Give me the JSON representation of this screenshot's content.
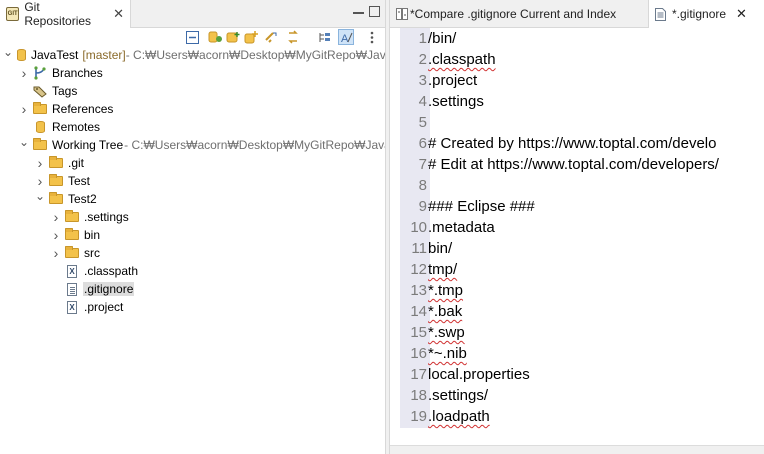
{
  "left_panel": {
    "tab_title": "Git Repositories",
    "tab_close": "✕",
    "git_icon_text": "GIT",
    "toolbar_icons": [
      "collapse-all-icon",
      "clone-repo-icon",
      "add-repo-icon",
      "create-repo-icon",
      "link-editor-icon",
      "refresh-icon",
      "flat-layout-icon",
      "show-content-icon",
      "view-menu-icon"
    ],
    "tree": [
      {
        "id": "javatest",
        "level": 0,
        "expanded": true,
        "icon": "repo-icon",
        "label": "JavaTest",
        "tag": "[master]",
        "path": " - C:₩Users₩acorn₩Desktop₩MyGitRepo₩JavaT"
      },
      {
        "id": "branches",
        "level": 1,
        "expanded": false,
        "icon": "branches-icon",
        "label": "Branches"
      },
      {
        "id": "tags",
        "level": 1,
        "expanded": null,
        "icon": "tags-icon",
        "label": "Tags"
      },
      {
        "id": "references",
        "level": 1,
        "expanded": false,
        "icon": "folder-icon",
        "label": "References"
      },
      {
        "id": "remotes",
        "level": 1,
        "expanded": null,
        "icon": "remotes-icon",
        "label": "Remotes"
      },
      {
        "id": "working-tree",
        "level": 1,
        "expanded": true,
        "icon": "folder-icon",
        "label": "Working Tree",
        "path": " - C:₩Users₩acorn₩Desktop₩MyGitRepo₩JavaT"
      },
      {
        "id": "git",
        "level": 2,
        "expanded": false,
        "icon": "folder-icon",
        "label": ".git"
      },
      {
        "id": "test",
        "level": 2,
        "expanded": false,
        "icon": "folder-icon",
        "label": "Test"
      },
      {
        "id": "test2",
        "level": 2,
        "expanded": true,
        "icon": "folder-icon",
        "label": "Test2"
      },
      {
        "id": "settings",
        "level": 3,
        "expanded": false,
        "icon": "folder-icon",
        "label": ".settings"
      },
      {
        "id": "bin",
        "level": 3,
        "expanded": false,
        "icon": "folder-icon",
        "label": "bin"
      },
      {
        "id": "src",
        "level": 3,
        "expanded": false,
        "icon": "folder-icon",
        "label": "src"
      },
      {
        "id": "classpath",
        "level": 3,
        "expanded": null,
        "icon": "xml-file-icon",
        "label": ".classpath"
      },
      {
        "id": "gitignore",
        "level": 3,
        "expanded": null,
        "icon": "text-file-icon",
        "label": ".gitignore",
        "selected": true
      },
      {
        "id": "project",
        "level": 3,
        "expanded": null,
        "icon": "xml-file-icon",
        "label": ".project"
      }
    ]
  },
  "editor": {
    "tabs": [
      {
        "label": "*Compare .gitignore Current and Index",
        "icon": "compare-icon",
        "active": false
      },
      {
        "label": "*.gitignore",
        "icon": "text-file-icon",
        "active": true,
        "close": "✕"
      }
    ],
    "lines": [
      {
        "n": "1",
        "text": "/bin/",
        "spell": false
      },
      {
        "n": "2",
        "text": ".classpath",
        "spell": true
      },
      {
        "n": "3",
        "text": ".project",
        "spell": false
      },
      {
        "n": "4",
        "text": ".settings",
        "spell": false
      },
      {
        "n": "5",
        "text": "",
        "spell": false
      },
      {
        "n": "6",
        "text": "# Created by https://www.toptal.com/develo",
        "spell": false
      },
      {
        "n": "7",
        "text": "# Edit at https://www.toptal.com/developers/",
        "spell": false
      },
      {
        "n": "8",
        "text": "",
        "spell": false
      },
      {
        "n": "9",
        "text": "### Eclipse ###",
        "spell": false
      },
      {
        "n": "10",
        "text": ".metadata",
        "spell": false
      },
      {
        "n": "11",
        "text": "bin/",
        "spell": false
      },
      {
        "n": "12",
        "text": "tmp/",
        "spell": true
      },
      {
        "n": "13",
        "text": "*.tmp",
        "spell": true
      },
      {
        "n": "14",
        "text": "*.bak",
        "spell": true
      },
      {
        "n": "15",
        "text": "*.swp",
        "spell": true
      },
      {
        "n": "16",
        "text": "*~.nib",
        "spell": true
      },
      {
        "n": "17",
        "text": "local.properties",
        "spell": false
      },
      {
        "n": "18",
        "text": ".settings/",
        "spell": false
      },
      {
        "n": "19",
        "text": ".loadpath",
        "spell": true
      }
    ]
  },
  "colors": {
    "selection": "#dddddd",
    "gutter": "#e8e8f2",
    "folder": "#f3c24a",
    "path_text": "#6f6f6f",
    "branch_tag": "#8a6a2a",
    "spell_underline": "#d03030"
  }
}
